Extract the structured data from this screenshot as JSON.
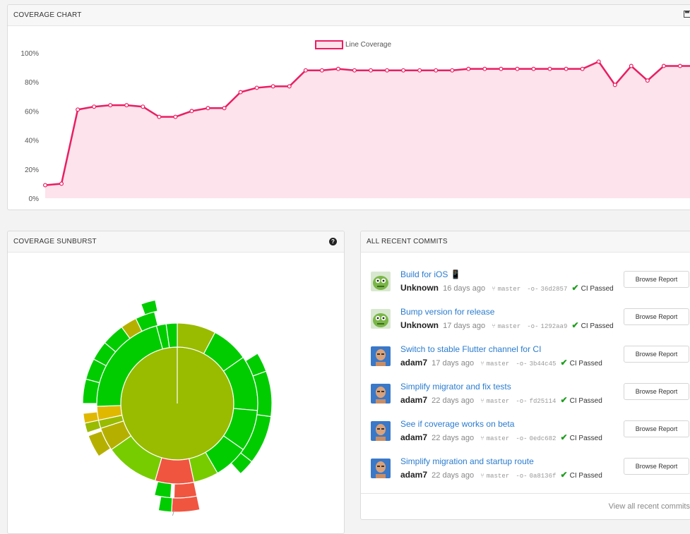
{
  "coverage_chart": {
    "header": "COVERAGE CHART",
    "save_icon": "save-icon",
    "colors": {
      "line": "#ea1e63",
      "fill": "#fde3ec"
    },
    "chart_data": {
      "type": "area",
      "title": "",
      "legend": [
        "Line Coverage"
      ],
      "legend_position": "top-center",
      "ylim": [
        0,
        100
      ],
      "yticks": [
        "0%",
        "20%",
        "40%",
        "60%",
        "80%",
        "100%"
      ],
      "grid": false,
      "series": [
        {
          "name": "Line Coverage",
          "values": [
            9,
            10,
            61,
            63,
            64,
            64,
            63,
            56,
            56,
            60,
            62,
            62,
            73,
            76,
            77,
            77,
            88,
            88,
            89,
            88,
            88,
            88,
            88,
            88,
            88,
            88,
            89,
            89,
            89,
            89,
            89,
            89,
            89,
            89,
            94,
            78,
            91,
            81,
            91,
            91,
            91
          ]
        }
      ]
    }
  },
  "sunburst": {
    "header": "COVERAGE SUNBURST",
    "help_icon": "question-circle-icon",
    "root_label": "/",
    "colors": {
      "green": "#00cc00",
      "olive": "#99bb00",
      "lime": "#77cc00",
      "khaki": "#b5b000",
      "yellow": "#e0b800",
      "red": "#f05540"
    }
  },
  "commits": {
    "header": "ALL RECENT COMMITS",
    "branch_icon": "git-branch-icon",
    "commit_icon": "git-commit-icon",
    "check_icon": "check-icon",
    "view_all": "View all recent commits",
    "items": [
      {
        "title": "Build for iOS 📱",
        "author": "Unknown",
        "time": "16 days ago",
        "branch": "master",
        "sha": "36d2857",
        "ci": "CI Passed",
        "button": "Browse Report",
        "avatar": "bot"
      },
      {
        "title": "Bump version for release",
        "author": "Unknown",
        "time": "17 days ago",
        "branch": "master",
        "sha": "1292aa9",
        "ci": "CI Passed",
        "button": "Browse Report",
        "avatar": "bot"
      },
      {
        "title": "Switch to stable Flutter channel for CI",
        "author": "adam7",
        "time": "17 days ago",
        "branch": "master",
        "sha": "3b44c45",
        "ci": "CI Passed",
        "button": "Browse Report",
        "avatar": "person"
      },
      {
        "title": "Simplify migrator and fix tests",
        "author": "adam7",
        "time": "22 days ago",
        "branch": "master",
        "sha": "fd25114",
        "ci": "CI Passed",
        "button": "Browse Report",
        "avatar": "person"
      },
      {
        "title": "See if coverage works on beta",
        "author": "adam7",
        "time": "22 days ago",
        "branch": "master",
        "sha": "0edc682",
        "ci": "CI Passed",
        "button": "Browse Report",
        "avatar": "person"
      },
      {
        "title": "Simplify migration and startup route",
        "author": "adam7",
        "time": "22 days ago",
        "branch": "master",
        "sha": "0a8136f",
        "ci": "CI Passed",
        "button": "Browse Report",
        "avatar": "person"
      }
    ]
  }
}
